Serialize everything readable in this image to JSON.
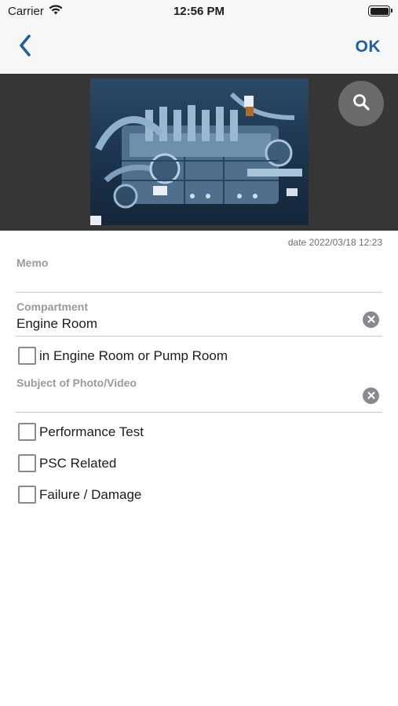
{
  "status_bar": {
    "carrier": "Carrier",
    "time": "12:56 PM",
    "wifi_icon": "wifi-icon",
    "battery_icon": "battery-icon"
  },
  "nav_bar": {
    "back_icon": "chevron-left-icon",
    "ok_label": "OK",
    "accent_color": "#1e5fa3"
  },
  "photo": {
    "zoom_icon": "magnifier-icon"
  },
  "meta": {
    "date": "date 2022/03/18 12:23"
  },
  "form": {
    "memo": {
      "label": "Memo",
      "value": ""
    },
    "compartment": {
      "label": "Compartment",
      "value": "Engine Room",
      "clear_icon": "clear-icon"
    },
    "engine_pump_checkbox": {
      "label": "in Engine Room or Pump Room",
      "checked": false
    },
    "subject": {
      "label": "Subject of Photo/Video",
      "value": "",
      "clear_icon": "clear-icon"
    },
    "checkboxes": [
      {
        "label": "Performance Test",
        "checked": false
      },
      {
        "label": "PSC Related",
        "checked": false
      },
      {
        "label": "Failure / Damage",
        "checked": false
      }
    ]
  }
}
